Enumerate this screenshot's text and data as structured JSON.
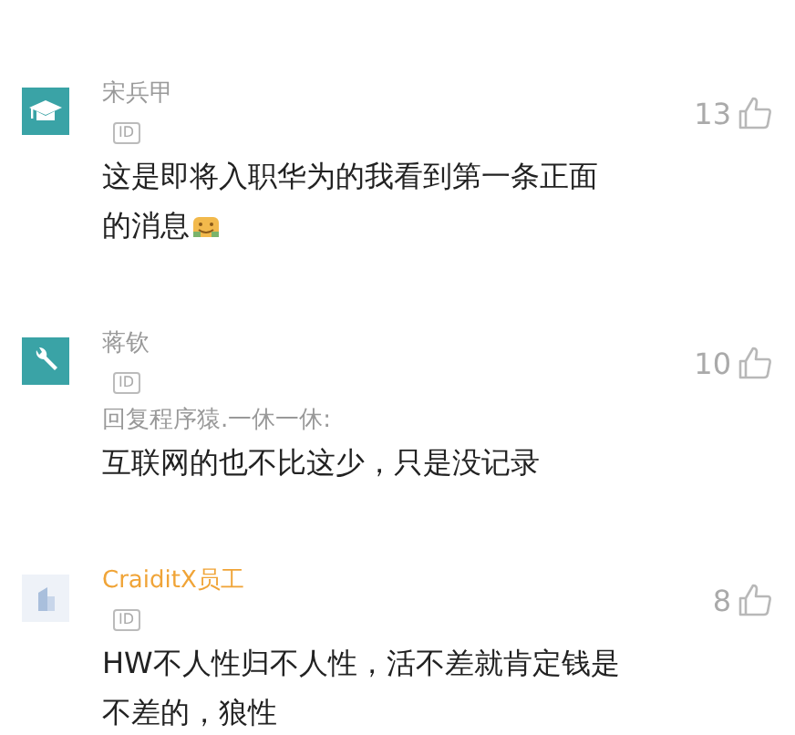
{
  "comments": [
    {
      "avatar": {
        "kind": "cap"
      },
      "author": {
        "name": "宋兵甲",
        "color": "#9a9a9a"
      },
      "badge": "ID",
      "likes": "13",
      "body": [
        "这是即将入职华为的我看到第一条正面",
        "的消息"
      ],
      "trailing_emoji": true
    },
    {
      "avatar": {
        "kind": "wrench"
      },
      "author": {
        "name": "蒋钦",
        "color": "#9a9a9a"
      },
      "badge": "ID",
      "likes": "10",
      "reply_to": "回复程序猿.一休一休:",
      "body": [
        "互联网的也不比这少，只是没记录"
      ],
      "trailing_emoji": false
    },
    {
      "avatar": {
        "kind": "building"
      },
      "author": {
        "name": "CraiditX员工",
        "color": "#f0a437"
      },
      "badge": "ID",
      "likes": "8",
      "body": [
        "HW不人性归不人性，活不差就肯定钱是",
        "不差的，狼性"
      ],
      "trailing_emoji": false
    }
  ]
}
